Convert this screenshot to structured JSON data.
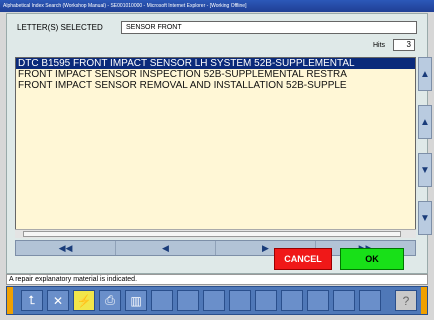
{
  "window": {
    "title": "Alphabetical Index Search (Workshop Manual) - SE001010000 - Microsoft Internet Explorer - [Working Offline]"
  },
  "search": {
    "letter_label": "LETTER(S) SELECTED",
    "letter_value": "SENSOR FRONT",
    "hits_label": "Hits",
    "hits_value": "3"
  },
  "results": [
    "DTC B1595 FRONT IMPACT SENSOR LH SYSTEM    52B-SUPPLEMENTAL",
    "FRONT IMPACT SENSOR INSPECTION    52B-SUPPLEMENTAL RESTRA",
    "FRONT IMPACT SENSOR REMOVAL AND INSTALLATION    52B-SUPPLE"
  ],
  "nav": {
    "first": "◀◀",
    "prev": "◀",
    "next": "▶",
    "last": "▶▶"
  },
  "scroll": {
    "up_fast": "▲",
    "up": "▲",
    "down": "▼",
    "down_fast": "▼"
  },
  "buttons": {
    "cancel": "CANCEL",
    "ok": "OK"
  },
  "status_text": "A repair explanatory material is indicated.",
  "toolbar_icons": [
    "back-icon",
    "close-icon",
    "flash-icon",
    "print-icon",
    "book-icon",
    "help-icon"
  ]
}
